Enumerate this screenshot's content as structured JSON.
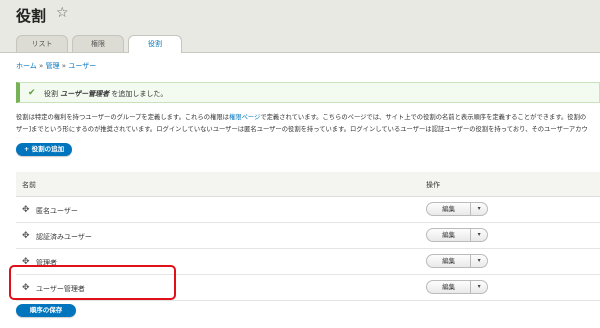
{
  "page": {
    "title": "役割",
    "star_icon": "star-outline-icon"
  },
  "tabs": [
    {
      "label": "リスト",
      "active": false
    },
    {
      "label": "権限",
      "active": false
    },
    {
      "label": "役割",
      "active": true
    }
  ],
  "breadcrumb": {
    "items": [
      "ホーム",
      "管理",
      "ユーザー"
    ],
    "separator": "»"
  },
  "message": {
    "prefix": "役割",
    "role_name": "ユーザー管理者",
    "suffix": "を追加しました。",
    "status_color": "#77b259"
  },
  "description": {
    "line1_before": "役割は特定の権利を持つユーザーのグループを定義します。これらの権限は",
    "line1_link": "権限ページ",
    "line1_after": "で定義されています。こちらのページでは、サイト上での役割の名前と表示順序を定義することができます。役割の",
    "line2": "ザー]までという形にするのが推奨されています。ログインしていないユーザーは匿名ユーザーの役割を持っています。ログインしているユーザーは認証ユーザーの役割を持っており、そのユーザーアカウ"
  },
  "add_button": {
    "label": "+ 役割の追加"
  },
  "table": {
    "headers": {
      "name": "名前",
      "operations": "操作"
    },
    "rows": [
      {
        "label": "匿名ユーザー",
        "edit": "編集"
      },
      {
        "label": "認証済みユーザー",
        "edit": "編集"
      },
      {
        "label": "管理者",
        "edit": "編集"
      },
      {
        "label": "ユーザー管理者",
        "edit": "編集"
      }
    ]
  },
  "save_button": {
    "label": "順序の保存"
  },
  "colors": {
    "accent": "#0074bd",
    "highlight": "#e0101a"
  }
}
